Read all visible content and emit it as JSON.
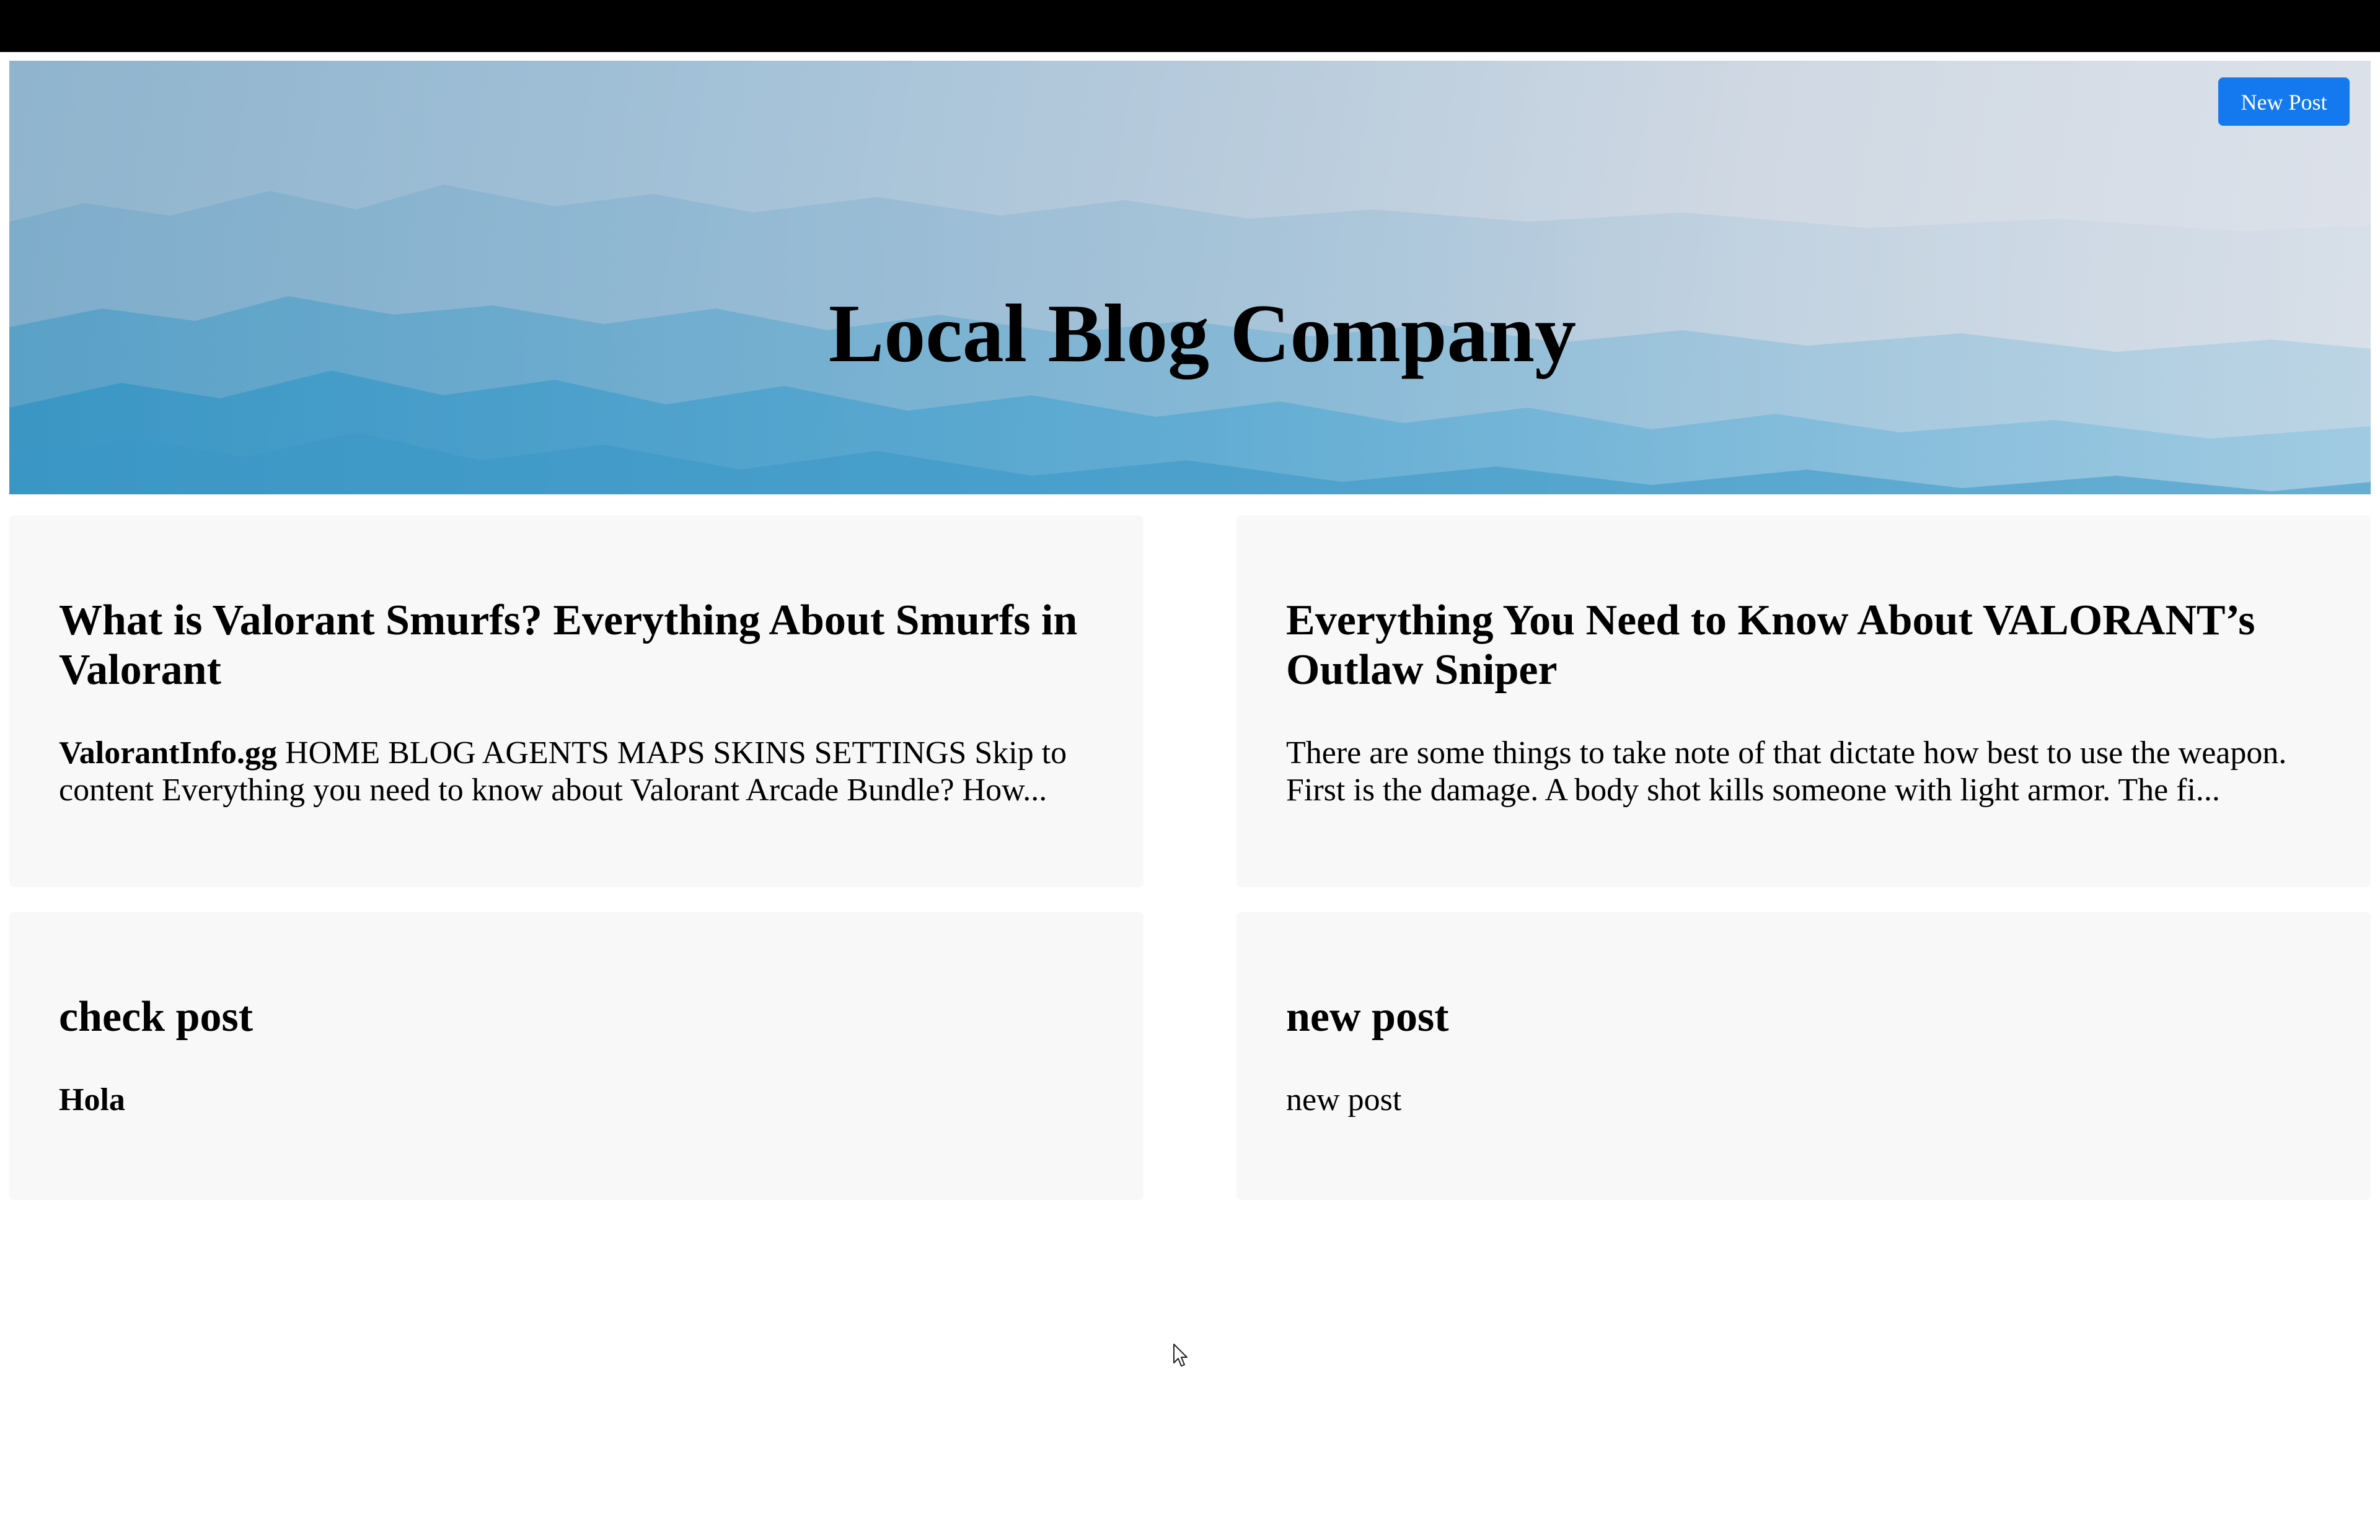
{
  "site": {
    "title": "Local Blog Company",
    "new_post_label": "New Post"
  },
  "posts": [
    {
      "title": "What is Valorant Smurfs? Everything About Smurfs in Valorant",
      "excerpt_bold": "ValorantInfo.gg",
      "excerpt": " HOME BLOG AGENTS MAPS SKINS SETTINGS Skip to content Everything you need to know about Valorant Arcade Bundle? How..."
    },
    {
      "title": "Everything You Need to Know About VALORANT’s Outlaw Sniper",
      "excerpt": "There are some things to take note of that dictate how best to use the weapon. First is the damage. A body shot kills someone with light armor. The fi..."
    },
    {
      "title": "check post",
      "excerpt_bold": "Hola"
    },
    {
      "title": "new post",
      "excerpt": "new post"
    }
  ],
  "colors": {
    "accent": "#1479ef",
    "card_bg": "#f8f8f8",
    "top_bar": "#000000"
  },
  "icons": {
    "cursor": "mouse-pointer-icon"
  }
}
